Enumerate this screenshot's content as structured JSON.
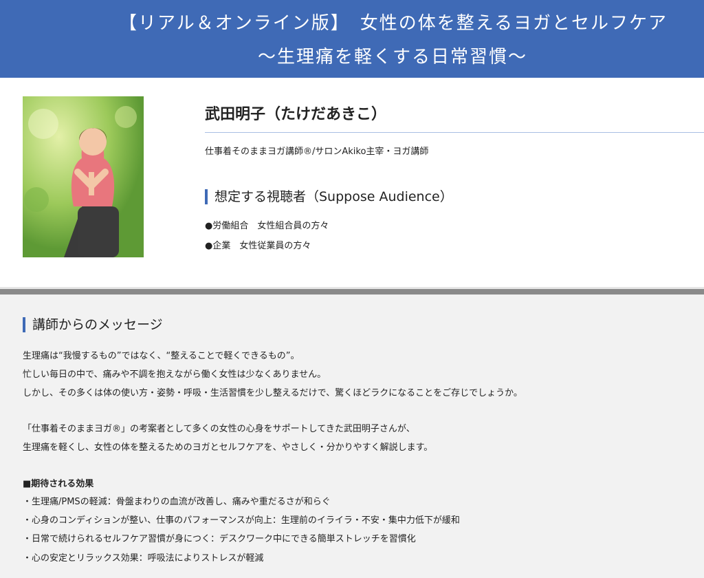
{
  "banner": {
    "line1": "【リアル＆オンライン版】　女性の体を整えるヨガとセルフケア",
    "line2": "〜生理痛を軽くする日常習慣〜"
  },
  "profile": {
    "name": "武田明子（たけだあきこ）",
    "role": "仕事着そのままヨガ講師®/サロンAkiko主宰・ヨガ講師",
    "audience_heading": "想定する視聴者（Suppose Audience）",
    "audience_items": [
      "●労働組合　女性組合員の方々",
      "●企業　女性従業員の方々"
    ]
  },
  "message": {
    "heading": "講師からのメッセージ",
    "para1": [
      "生理痛は“我慢するもの”ではなく、“整えることで軽くできるもの”。",
      "忙しい毎日の中で、痛みや不調を抱えながら働く女性は少なくありません。",
      "しかし、その多くは体の使い方・姿勢・呼吸・生活習慣を少し整えるだけで、驚くほどラクになることをご存じでしょうか。"
    ],
    "para2": [
      "「仕事着そのままヨガ®」の考案者として多くの女性の心身をサポートしてきた武田明子さんが、",
      "生理痛を軽くし、女性の体を整えるためのヨガとセルフケアを、やさしく・分かりやすく解説します。"
    ],
    "effects_heading": "■期待される効果",
    "effects": [
      "・生理痛/PMSの軽減：骨盤まわりの血流が改善し、痛みや重だるさが和らぐ",
      "・心身のコンディションが整い、仕事のパフォーマンスが向上：生理前のイライラ・不安・集中力低下が緩和",
      "・日常で続けられるセルフケア習慣が身につく：デスクワーク中にできる簡単ストレッチを習慣化",
      "・心の安定とリラックス効果：呼吸法によりストレスが軽減"
    ]
  },
  "colors": {
    "banner": "#3f6ab6",
    "accent_bar": "#3f6ab6"
  }
}
